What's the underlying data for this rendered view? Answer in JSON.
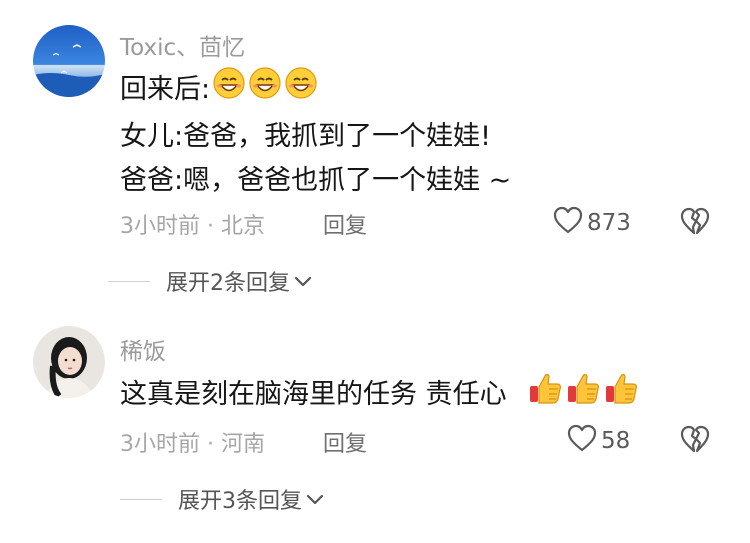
{
  "comments": [
    {
      "username": "Toxic、茴忆",
      "lines": [
        "回来后:",
        "女儿:爸爸，我抓到了一个娃娃!",
        "爸爸:嗯，爸爸也抓了一个娃娃 ~"
      ],
      "line1_emojis": [
        "grinning-face-emoji",
        "grinning-face-emoji",
        "grinning-face-emoji"
      ],
      "meta": "3小时前 · 北京",
      "reply_label": "回复",
      "likes": "873",
      "expand_label": "展开2条回复"
    },
    {
      "username": "稀饭",
      "lines": [
        "这真是刻在脑海里的任务  责任心"
      ],
      "line1_emojis": [
        "thumbs-up-emoji",
        "thumbs-up-emoji",
        "thumbs-up-emoji"
      ],
      "meta": "3小时前 · 河南",
      "reply_label": "回复",
      "likes": "58",
      "expand_label": "展开3条回复"
    }
  ],
  "icons": {
    "like": "heart-outline-icon",
    "dislike": "broken-heart-icon",
    "expand": "chevron-down-icon"
  },
  "colors": {
    "username": "#9a9a9a",
    "text": "#161616",
    "meta": "#a6a6a6"
  }
}
